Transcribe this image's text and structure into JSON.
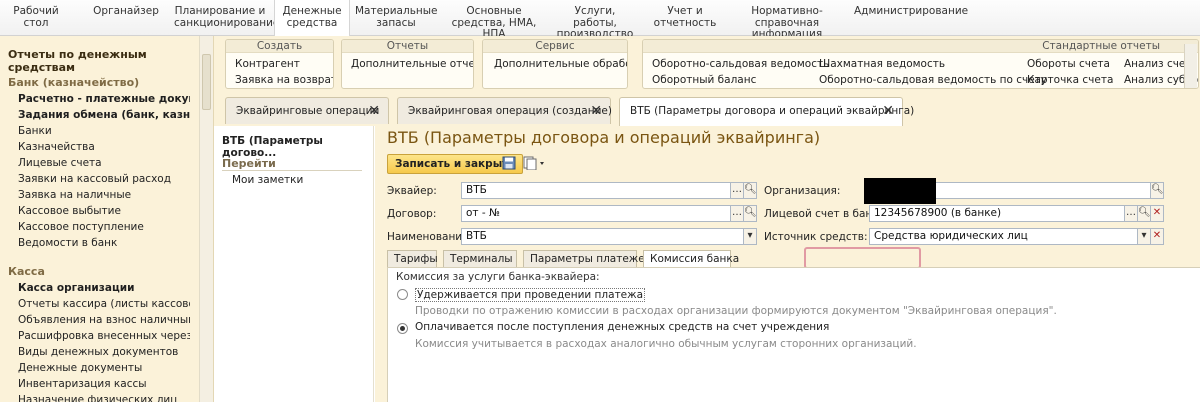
{
  "sections": [
    {
      "label": "Рабочий стол"
    },
    {
      "label": "Органайзер"
    },
    {
      "label": "Планирование и санкционирование"
    },
    {
      "label": "Денежные средства"
    },
    {
      "label": "Материальные запасы"
    },
    {
      "label": "Основные средства, НМА, НПА"
    },
    {
      "label": "Услуги, работы, производство"
    },
    {
      "label": "Учет и отчетность"
    },
    {
      "label": "Нормативно-справочная информация"
    },
    {
      "label": "Администрирование"
    }
  ],
  "sidebar": {
    "title": "Отчеты по денежным средствам",
    "group_bank": "Банк (казначейство)",
    "bank_items": [
      {
        "label": "Расчетно - платежные докуме..."
      },
      {
        "label": "Задания обмена (банк, казна..."
      },
      {
        "label": "Банки"
      },
      {
        "label": "Казначейства"
      },
      {
        "label": "Лицевые счета"
      },
      {
        "label": "Заявки на кассовый расход"
      },
      {
        "label": "Заявка на наличные"
      },
      {
        "label": "Кассовое выбытие"
      },
      {
        "label": "Кассовое поступление"
      },
      {
        "label": "Ведомости в банк"
      }
    ],
    "group_cash": "Касса",
    "cash_items": [
      {
        "label": "Касса организации"
      },
      {
        "label": "Отчеты кассира (листы кассовой к..."
      },
      {
        "label": "Объявления на взнос наличными"
      },
      {
        "label": "Расшифровка внесенных через бан..."
      },
      {
        "label": "Виды денежных документов"
      },
      {
        "label": "Денежные документы"
      },
      {
        "label": "Инвентаризация кассы"
      },
      {
        "label": "Назначение физических лиц"
      }
    ]
  },
  "commands": {
    "create_header": "Создать",
    "create_items": [
      "Контрагент",
      "Заявка на возврат"
    ],
    "reports_header": "Отчеты",
    "reports_items": [
      "Дополнительные отчеты"
    ],
    "service_header": "Сервис",
    "service_items": [
      "Дополнительные обработки"
    ],
    "standard_header": "Стандартные отчеты",
    "standard_items": [
      "Оборотно-сальдовая ведомость",
      "Оборотный баланс",
      "Шахматная ведомость",
      "Оборотно-сальдовая ведомость по счету",
      "Обороты счета",
      "Карточка счета",
      "Анализ счета",
      "Анализ субконто"
    ]
  },
  "tabs": [
    {
      "label": "Эквайринговые операции"
    },
    {
      "label": "Эквайринговая операция (создание)"
    },
    {
      "label": "ВТБ (Параметры договора и операций эквайринга)"
    }
  ],
  "panel": {
    "title": "ВТБ (Параметры догово...",
    "goto": "Перейти",
    "notes": "Мои заметки"
  },
  "form": {
    "title": "ВТБ (Параметры договора и операций эквайринга)",
    "save_close": "Записать и закрыть",
    "acquirer_label": "Эквайер:",
    "acquirer_value": "ВТБ",
    "contract_label": "Договор:",
    "contract_value": "от - №",
    "name_label": "Наименование:",
    "name_value": "ВТБ",
    "org_label": "Организация:",
    "org_value": "",
    "account_label": "Лицевой счет в банке:",
    "account_value": "12345678900 (в банке)",
    "funds_label": "Источник средств:",
    "funds_value": "Средства юридических лиц",
    "inner_tabs": [
      {
        "label": "Тарифы"
      },
      {
        "label": "Терминалы"
      },
      {
        "label": "Параметры платежей"
      },
      {
        "label": "Комиссия банка"
      }
    ],
    "commission_caption": "Комиссия за услуги банка-эквайера:",
    "opt1": "Удерживается при проведении платежа",
    "opt1_hint": "Проводки по отражению комиссии в расходах организации формируются документом \"Эквайринговая операция\".",
    "opt2": "Оплачивается после поступления денежных средств на счет учреждения",
    "opt2_hint": "Комиссия учитывается в расходах аналогично обычным услугам сторонних организаций.",
    "selected_option": 2
  }
}
